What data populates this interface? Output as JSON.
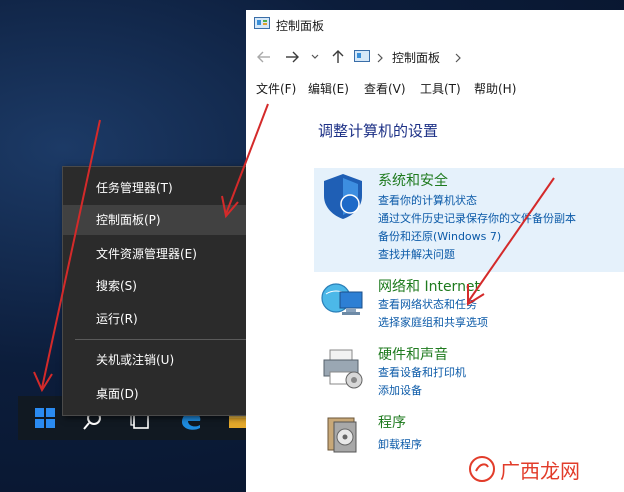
{
  "context_menu": {
    "items": [
      {
        "label": "任务管理器(T)"
      },
      {
        "label": "控制面板(P)"
      },
      {
        "label": "文件资源管理器(E)"
      },
      {
        "label": "搜索(S)"
      },
      {
        "label": "运行(R)"
      },
      {
        "label": "关机或注销(U)"
      },
      {
        "label": "桌面(D)"
      }
    ]
  },
  "window": {
    "title": "控制面板",
    "address": "控制面板",
    "menubar": [
      "文件(F)",
      "编辑(E)",
      "查看(V)",
      "工具(T)",
      "帮助(H)"
    ],
    "heading": "调整计算机的设置",
    "categories": [
      {
        "title": "系统和安全",
        "links": [
          "查看你的计算机状态",
          "通过文件历史记录保存你的文件备份副本",
          "备份和还原(Windows 7)",
          "查找并解决问题"
        ]
      },
      {
        "title": "网络和 Internet",
        "links": [
          "查看网络状态和任务",
          "选择家庭组和共享选项"
        ]
      },
      {
        "title": "硬件和声音",
        "links": [
          "查看设备和打印机",
          "添加设备"
        ]
      },
      {
        "title": "程序",
        "links": [
          "卸载程序"
        ]
      }
    ]
  },
  "watermark": {
    "text": "广西龙网"
  },
  "colors": {
    "menu_bg": "#2b2b2b",
    "menu_highlight": "#414141",
    "link": "#0b5aa8",
    "category_title": "#1e7a1e",
    "heading": "#1e3287",
    "arrow": "#d42a2a",
    "hover_bg": "#e5f1fb"
  }
}
